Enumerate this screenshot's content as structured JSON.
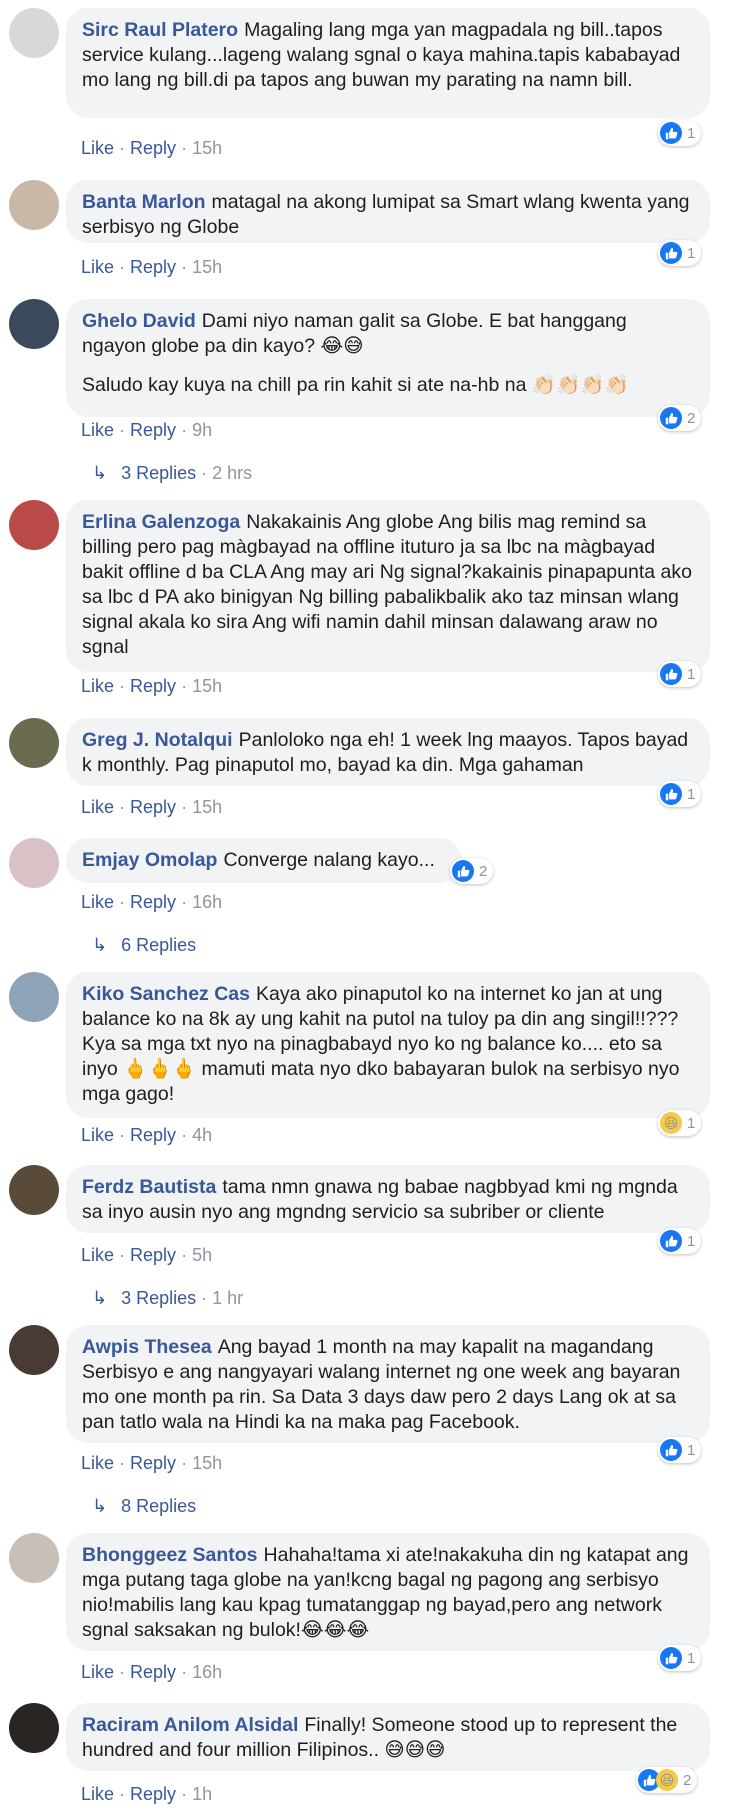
{
  "colors": {
    "name": "#385898",
    "bubble": "#f2f3f5",
    "like_blue": "#1877f2",
    "muted": "#90949c"
  },
  "actions": {
    "like": "Like",
    "reply": "Reply",
    "sep": "·"
  },
  "comments": [
    {
      "name": "Sirc Raul Platero",
      "text": "Magaling lang mga yan magpadala ng bill..tapos service kulang...lageng walang sgnal o kaya mahina.tapis kababayad mo lang ng bill.di pa tapos ang buwan my parating na namn bill.",
      "time": "15h",
      "reaction_count": "1"
    },
    {
      "name": "Banta Marlon",
      "text": "matagal na akong lumipat sa Smart wlang kwenta yang serbisyo ng Globe",
      "time": "15h",
      "reaction_count": "1"
    },
    {
      "name": "Ghelo David",
      "text": "Dami niyo naman galit sa Globe. E bat hanggang ngayon globe pa din kayo? 😂😅",
      "text2": "Saludo kay kuya na chill pa rin kahit si ate na-hb na 👏🏻👏🏻👏🏻👏🏻",
      "time": "9h",
      "reaction_count": "2",
      "replies": "3 Replies",
      "replies_time": "2 hrs"
    },
    {
      "name": "Erlina Galenzoga",
      "text": "Nakakainis Ang globe Ang bilis mag remind sa billing pero pag màgbayad na offline ituturo ja sa lbc na màgbayad bakit offline d ba CLA Ang may ari Ng signal?kakainis pinapapunta ako sa lbc d PA ako binigyan Ng billing pabalikbalik ako taz minsan wlang signal akala ko sira Ang wifi namin dahil minsan dalawang araw no sgnal",
      "time": "15h",
      "reaction_count": "1"
    },
    {
      "name": "Greg J. Notalqui",
      "text": "Panloloko nga eh! 1 week lng maayos. Tapos bayad k monthly. Pag pinaputol mo, bayad ka din. Mga gahaman",
      "time": "15h",
      "reaction_count": "1"
    },
    {
      "name": "Emjay Omolap",
      "text": "Converge nalang kayo...",
      "time": "16h",
      "reaction_count": "2",
      "replies": "6 Replies"
    },
    {
      "name": "Kiko Sanchez Cas",
      "text": "Kaya ako pinaputol ko na internet ko jan at ung balance ko na 8k ay ung kahit na putol na tuloy pa din ang singil!!??? Kya sa mga txt nyo na pinagbabayd nyo ko ng balance ko.... eto sa inyo 🖕🖕🖕 mamuti mata nyo dko babayaran bulok na serbisyo nyo mga gago!",
      "time": "4h",
      "reaction_count": "1"
    },
    {
      "name": "Ferdz Bautista",
      "text": "tama nmn gnawa ng babae nagbbyad kmi ng mgnda sa inyo ausin nyo ang mgndng servicio sa subriber or cliente",
      "time": "5h",
      "reaction_count": "1",
      "replies": "3 Replies",
      "replies_time": "1 hr"
    },
    {
      "name": "Awpis Thesea",
      "text": "Ang bayad 1 month na may kapalit na magandang Serbisyo e ang nangyayari walang internet ng one week ang bayaran mo one month pa rin. Sa Data 3 days daw pero 2 days Lang ok at sa pan tatlo wala na Hindi ka na maka pag Facebook.",
      "time": "15h",
      "reaction_count": "1",
      "replies": "8 Replies"
    },
    {
      "name": "Bhonggeez Santos",
      "text": "Hahaha!tama xi ate!nakakuha din ng katapat ang mga putang taga globe na yan!kcng bagal ng pagong ang serbisyo nio!mabilis lang kau kpag tumatanggap ng bayad,pero ang network sgnal saksakan ng bulok!😂😂😂",
      "time": "16h",
      "reaction_count": "1"
    },
    {
      "name": "Raciram Anilom Alsidal",
      "text": "Finally! Someone stood up to represent the hundred and four million Filipinos.. 😅😅😅",
      "time": "1h",
      "reaction_count": "2"
    }
  ]
}
